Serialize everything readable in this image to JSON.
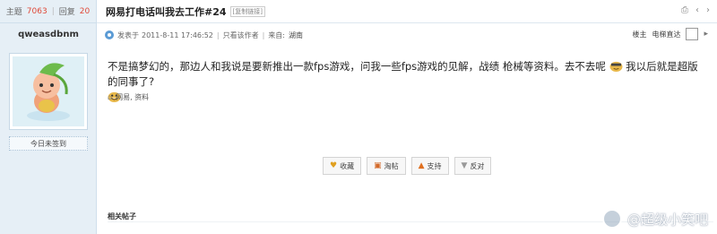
{
  "sidebar": {
    "stats": {
      "theme_label": "主题",
      "theme_count": "7063",
      "replies_label": "回复",
      "replies_count": "20"
    },
    "username": "qweasdbnm",
    "sign_button": "今日未签到"
  },
  "post": {
    "title": "网易打电话叫我去工作#24",
    "title_tag": "[复制链接]",
    "meta": {
      "posted_prefix": "发表于",
      "posted_time": "2011-8-11 17:46:52",
      "only_author": "只看该作者",
      "source_prefix": "来自:",
      "source": "湖南"
    },
    "floor_label": "楼主",
    "jump_label": "电梯直达",
    "content_part1": "不是搞梦幻的，那边人和我说是要新推出一款fps游戏，问我一些fps游戏的见解，战绩 枪械等资料。去不去呢",
    "content_part2": "我以后就是超版的同事了?",
    "tags": "网易, 资料",
    "actions": {
      "favorite": "收藏",
      "share": "淘帖",
      "support": "支持",
      "oppose": "反对"
    },
    "related_label": "相关帖子"
  },
  "watermark": "@超级小笑吧",
  "colors": {
    "sidebar_bg": "#e6eff6",
    "stat_number": "#e04a3a"
  }
}
